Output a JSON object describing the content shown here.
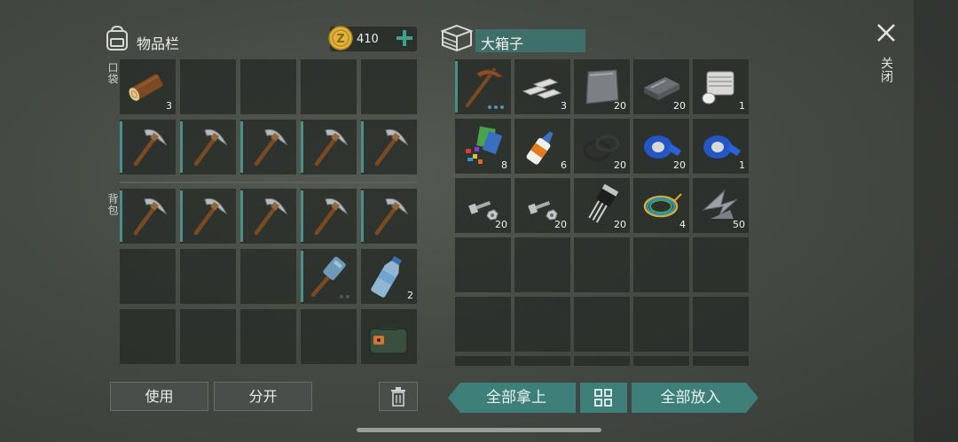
{
  "inventory": {
    "title": "物品栏",
    "coins": "410",
    "pocket_label": "口袋",
    "backpack_label": "背包",
    "slots": [
      {
        "item": "log",
        "count": "3"
      },
      {
        "item": "empty",
        "count": ""
      },
      {
        "item": "empty",
        "count": ""
      },
      {
        "item": "empty",
        "count": ""
      },
      {
        "item": "empty",
        "count": ""
      },
      {
        "item": "pickaxe",
        "count": ""
      },
      {
        "item": "pickaxe",
        "count": ""
      },
      {
        "item": "pickaxe",
        "count": ""
      },
      {
        "item": "pickaxe",
        "count": ""
      },
      {
        "item": "pickaxe",
        "count": ""
      },
      {
        "item": "pickaxe",
        "count": ""
      },
      {
        "item": "pickaxe",
        "count": ""
      },
      {
        "item": "pickaxe",
        "count": ""
      },
      {
        "item": "pickaxe",
        "count": ""
      },
      {
        "item": "pickaxe",
        "count": ""
      },
      {
        "item": "empty",
        "count": ""
      },
      {
        "item": "empty",
        "count": ""
      },
      {
        "item": "empty",
        "count": ""
      },
      {
        "item": "sledgehammer",
        "count": ""
      },
      {
        "item": "water-bottle",
        "count": "2"
      },
      {
        "item": "empty",
        "count": ""
      },
      {
        "item": "empty",
        "count": ""
      },
      {
        "item": "empty",
        "count": ""
      },
      {
        "item": "empty",
        "count": ""
      },
      {
        "item": "dynamite-bag",
        "count": ""
      }
    ],
    "use_button": "使用",
    "split_button": "分开"
  },
  "chest": {
    "title": "大箱子",
    "slots": [
      {
        "item": "pickaxe-large",
        "count": ""
      },
      {
        "item": "iron-bars",
        "count": "3"
      },
      {
        "item": "metal-plate",
        "count": "20"
      },
      {
        "item": "steel-ingot",
        "count": "20"
      },
      {
        "item": "engine-part",
        "count": "1"
      },
      {
        "item": "fabric-scraps",
        "count": "8"
      },
      {
        "item": "glue",
        "count": "6"
      },
      {
        "item": "rubber-seal",
        "count": "20"
      },
      {
        "item": "blue-tape",
        "count": "20"
      },
      {
        "item": "blue-tape",
        "count": "1"
      },
      {
        "item": "bolts",
        "count": "20"
      },
      {
        "item": "bolts",
        "count": "20"
      },
      {
        "item": "transistor",
        "count": "20"
      },
      {
        "item": "wires",
        "count": "4"
      },
      {
        "item": "metal-scraps",
        "count": "50"
      }
    ],
    "take_all": "全部拿上",
    "put_all": "全部放入"
  },
  "close_label": "关闭",
  "colors": {
    "accent_teal": "#3f7f79",
    "selection": "#4a8f8a",
    "coin": "#e0b43a"
  }
}
